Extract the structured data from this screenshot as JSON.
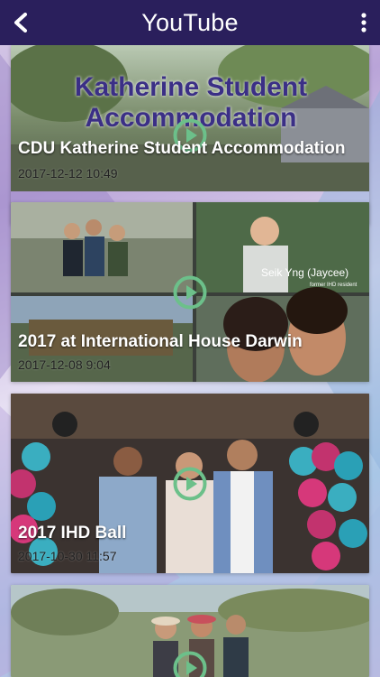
{
  "header": {
    "title": "YouTube",
    "back_icon": "chevron-left-icon",
    "menu_icon": "more-vertical-icon",
    "background_color": "#2a1f5c"
  },
  "thumbnail_texts": {
    "card1_line1": "Katherine Student",
    "card1_line2": "Accommodation",
    "card2_name": "Seik Yng (Jaycee)",
    "card2_caption": "former IHD resident"
  },
  "videos": [
    {
      "title": "CDU Katherine Student Accommodation",
      "date": "2017-12-12 10:49"
    },
    {
      "title": "2017 at International House Darwin",
      "date": "2017-12-08 9:04"
    },
    {
      "title": "2017 IHD Ball",
      "date": "2017-10-30 11:57"
    },
    {
      "title": "",
      "date": ""
    }
  ],
  "accent": {
    "play_ring": "#6cc08a"
  }
}
